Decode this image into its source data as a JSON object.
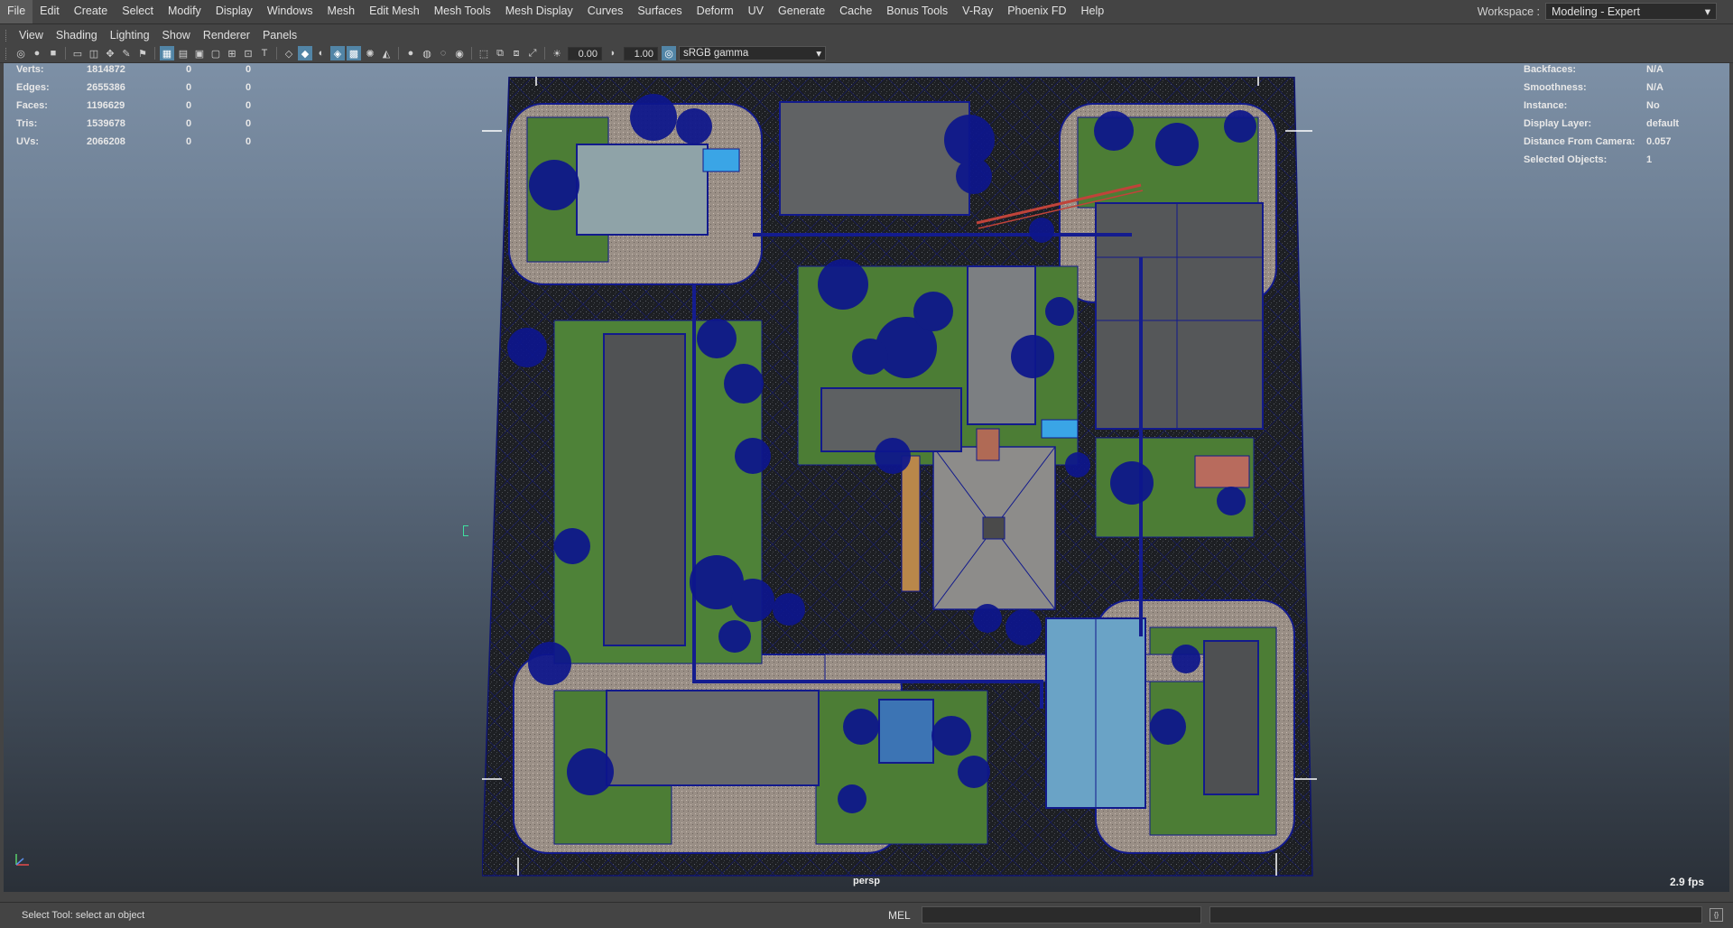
{
  "menu": [
    "File",
    "Edit",
    "Create",
    "Select",
    "Modify",
    "Display",
    "Windows",
    "Mesh",
    "Edit Mesh",
    "Mesh Tools",
    "Mesh Display",
    "Curves",
    "Surfaces",
    "Deform",
    "UV",
    "Generate",
    "Cache",
    "Bonus Tools",
    "V-Ray",
    "Phoenix FD",
    "Help"
  ],
  "workspace": {
    "label": "Workspace :",
    "value": "Modeling - Expert"
  },
  "panel_menu": [
    "View",
    "Shading",
    "Lighting",
    "Show",
    "Renderer",
    "Panels"
  ],
  "toolbar": {
    "exposure": "0.00",
    "gamma": "1.00",
    "color_space": "sRGB gamma",
    "icons": [
      "select-camera-icon",
      "camera-attributes-icon",
      "bookmark-icon",
      "image-plane-icon",
      "grid-icon",
      "film-gate-icon",
      "resolution-gate-icon",
      "gate-mask-icon",
      "field-chart-icon",
      "safe-action-icon",
      "wireframe-icon",
      "smooth-shade-icon",
      "wireframe-on-shaded-icon",
      "xray-icon",
      "default-material-icon",
      "textured-icon",
      "use-all-lights-icon",
      "shadows-icon",
      "ambient-occlusion-icon",
      "motion-blur-icon",
      "multisample-aa-icon",
      "depth-of-field-icon",
      "isolate-select-icon",
      "xray-active-icon",
      "xray-joints-icon"
    ]
  },
  "hud": {
    "stats": [
      {
        "label": "Verts:",
        "v1": "1814872",
        "v2": "0",
        "v3": "0"
      },
      {
        "label": "Edges:",
        "v1": "2655386",
        "v2": "0",
        "v3": "0"
      },
      {
        "label": "Faces:",
        "v1": "1196629",
        "v2": "0",
        "v3": "0"
      },
      {
        "label": "Tris:",
        "v1": "1539678",
        "v2": "0",
        "v3": "0"
      },
      {
        "label": "UVs:",
        "v1": "2066208",
        "v2": "0",
        "v3": "0"
      }
    ],
    "info": [
      {
        "label": "Backfaces:",
        "value": "N/A"
      },
      {
        "label": "Smoothness:",
        "value": "N/A"
      },
      {
        "label": "Instance:",
        "value": "No"
      },
      {
        "label": "Display Layer:",
        "value": "default"
      },
      {
        "label": "Distance From Camera:",
        "value": "0.057"
      },
      {
        "label": "Selected Objects:",
        "value": "1"
      }
    ],
    "camera": "persp",
    "fps": "2.9 fps"
  },
  "status": {
    "message": "Select Tool: select an object",
    "mel": "MEL"
  }
}
